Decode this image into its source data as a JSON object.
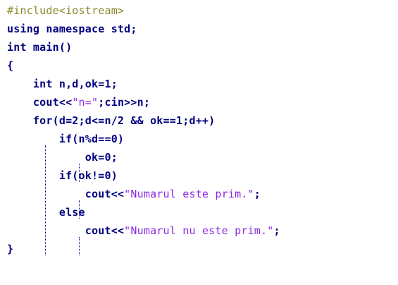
{
  "editor": {
    "lines": [
      {
        "tokens": [
          {
            "t": "#include<iostream>",
            "c": "pp"
          }
        ]
      },
      {
        "tokens": [
          {
            "t": "using namespace std;",
            "c": "kw"
          }
        ]
      },
      {
        "tokens": [
          {
            "t": "int main()",
            "c": "kw"
          }
        ]
      },
      {
        "tokens": [
          {
            "t": "{",
            "c": "brace"
          }
        ]
      },
      {
        "tokens": [
          {
            "t": "    int n,d,ok=1;",
            "c": "kw"
          }
        ]
      },
      {
        "tokens": [
          {
            "t": "    cout<<",
            "c": "id"
          },
          {
            "t": "\"n=\"",
            "c": "str"
          },
          {
            "t": ";cin>>n;",
            "c": "id"
          }
        ]
      },
      {
        "tokens": [
          {
            "t": "    for(d=2;d<=n/2 && ok==1;d++)",
            "c": "kw"
          }
        ]
      },
      {
        "tokens": [
          {
            "t": "        if(n%d==0)",
            "c": "kw"
          }
        ]
      },
      {
        "tokens": [
          {
            "t": "            ok=0;",
            "c": "id"
          }
        ]
      },
      {
        "tokens": [
          {
            "t": "        if(ok!=0)",
            "c": "kw"
          }
        ]
      },
      {
        "tokens": [
          {
            "t": "            cout<<",
            "c": "id"
          },
          {
            "t": "\"Numarul este prim.\"",
            "c": "str"
          },
          {
            "t": ";",
            "c": "id"
          }
        ]
      },
      {
        "tokens": [
          {
            "t": "        else",
            "c": "kw"
          }
        ]
      },
      {
        "tokens": [
          {
            "t": "            cout<<",
            "c": "id"
          },
          {
            "t": "\"Numarul nu este prim.\"",
            "c": "str"
          },
          {
            "t": ";",
            "c": "id"
          }
        ]
      },
      {
        "tokens": [
          {
            "t": "}",
            "c": "brace"
          }
        ]
      }
    ]
  },
  "colors": {
    "preprocessor": "#8a8a2a",
    "keyword": "#000080",
    "string": "#8a2be2",
    "background": "#ffffff",
    "indent_guide": "#0a0aa0"
  }
}
